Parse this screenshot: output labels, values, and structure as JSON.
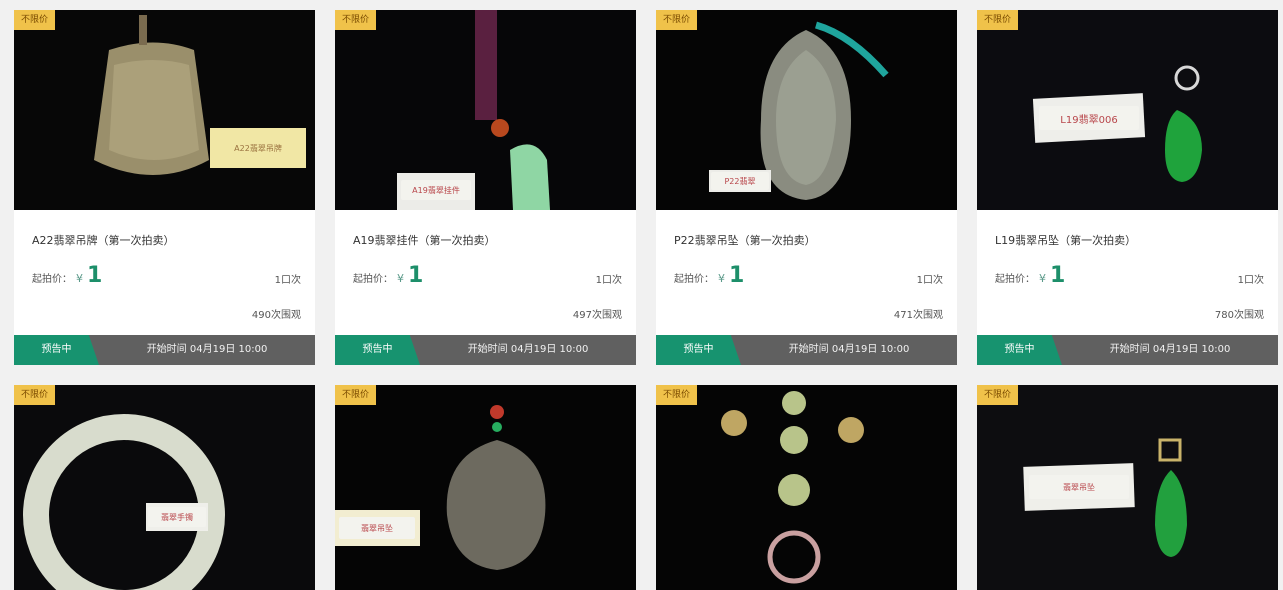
{
  "cards": [
    {
      "tag": "不限价",
      "title": "A22翡翠吊牌（第一次拍卖）",
      "start_price_label": "起拍价：",
      "currency": "¥",
      "start_price": "1",
      "bids": "1口次",
      "views": "490次围观",
      "status": "预告中",
      "time": "开始时间 04月19日 10:00",
      "label_text": "A22翡翠吊牌"
    },
    {
      "tag": "不限价",
      "title": "A19翡翠挂件（第一次拍卖）",
      "start_price_label": "起拍价：",
      "currency": "¥",
      "start_price": "1",
      "bids": "1口次",
      "views": "497次围观",
      "status": "预告中",
      "time": "开始时间 04月19日 10:00",
      "label_text": "A19翡翠挂件"
    },
    {
      "tag": "不限价",
      "title": "P22翡翠吊坠（第一次拍卖）",
      "start_price_label": "起拍价：",
      "currency": "¥",
      "start_price": "1",
      "bids": "1口次",
      "views": "471次围观",
      "status": "预告中",
      "time": "开始时间 04月19日 10:00",
      "label_text": "P22翡翠"
    },
    {
      "tag": "不限价",
      "title": "L19翡翠吊坠（第一次拍卖）",
      "start_price_label": "起拍价：",
      "currency": "¥",
      "start_price": "1",
      "bids": "1口次",
      "views": "780次围观",
      "status": "预告中",
      "time": "开始时间 04月19日 10:00",
      "label_text": "L19翡翠006"
    },
    {
      "tag": "不限价",
      "label_text": "翡翠手镯"
    },
    {
      "tag": "不限价",
      "label_text": "翡翠吊坠"
    },
    {
      "tag": "不限价",
      "label_text": ""
    },
    {
      "tag": "不限价",
      "label_text": "翡翠吊坠"
    }
  ],
  "colors": {
    "accent_green": "#17936f",
    "status_bar": "#606060",
    "tag_yellow": "#f0c24a"
  }
}
